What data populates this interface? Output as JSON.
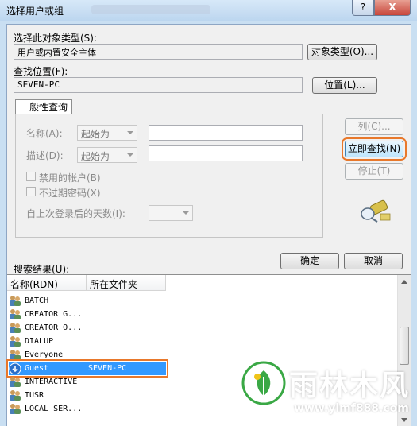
{
  "window": {
    "title": "选择用户或组",
    "help_glyph": "?",
    "close_glyph": "X"
  },
  "object_type": {
    "label": "选择此对象类型(S):",
    "value": "用户或内置安全主体",
    "button": "对象类型(O)..."
  },
  "location": {
    "label": "查找位置(F):",
    "value": "SEVEN-PC",
    "button": "位置(L)..."
  },
  "query": {
    "tab": "一般性查询",
    "name_label": "名称(A):",
    "name_combo": "起始为",
    "desc_label": "描述(D):",
    "desc_combo": "起始为",
    "disabled_accounts": "禁用的帐户(B)",
    "non_expiring": "不过期密码(X)",
    "days_label": "自上次登录后的天数(I):"
  },
  "side_buttons": {
    "columns": "列(C)...",
    "find_now": "立即查找(N)",
    "stop": "停止(T)"
  },
  "actions": {
    "ok": "确定",
    "cancel": "取消"
  },
  "results": {
    "label": "搜索结果(U):",
    "col_name": "名称(RDN)",
    "col_folder": "所在文件夹",
    "rows": [
      {
        "name": "BATCH",
        "folder": ""
      },
      {
        "name": "CREATOR G...",
        "folder": ""
      },
      {
        "name": "CREATOR O...",
        "folder": ""
      },
      {
        "name": "DIALUP",
        "folder": ""
      },
      {
        "name": "Everyone",
        "folder": ""
      },
      {
        "name": "Guest",
        "folder": "SEVEN-PC"
      },
      {
        "name": "INTERACTIVE",
        "folder": ""
      },
      {
        "name": "IUSR",
        "folder": ""
      },
      {
        "name": "LOCAL SER...",
        "folder": ""
      }
    ],
    "selected_index": 5
  },
  "watermark": {
    "brand": "雨林木风",
    "url": "www.ylmf888.com"
  },
  "colors": {
    "highlight": "#e8782b",
    "selection": "#3399ff",
    "watermark_green": "#3aa845"
  }
}
